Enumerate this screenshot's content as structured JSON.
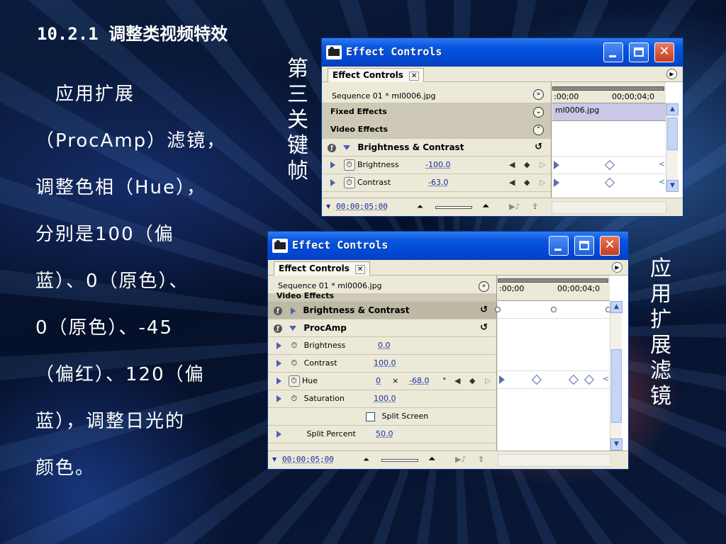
{
  "slide": {
    "title": "10.2.1 调整类视频特效",
    "body_lines": [
      "　应用扩展",
      "（ProcAmp）滤镜，",
      "调整色相（Hue），",
      "分别是100（偏",
      "蓝）、0（原色）、",
      "0（原色）、-45",
      "（偏红）、120（偏",
      "蓝），调整日光的",
      "颜色。"
    ],
    "label_keyframes": [
      "第",
      "三",
      "关",
      "键",
      "帧"
    ],
    "label_procamp": [
      "应",
      "用",
      "扩",
      "展",
      "滤",
      "镜"
    ]
  },
  "window1": {
    "title": "Effect Controls",
    "tab": "Effect Controls",
    "sequence": "Sequence 01 * ml0006.jpg",
    "ruler_start": ":00;00",
    "ruler_end": "00;00;04;0",
    "clip_name": "ml0006.jpg",
    "fixed_effects": "Fixed Effects",
    "video_effects": "Video Effects",
    "effect_group": "Brightness & Contrast",
    "params": [
      {
        "name": "Brightness",
        "value": "-100.0"
      },
      {
        "name": "Contrast",
        "value": "-63.0"
      }
    ],
    "timecode": "00;00;05;00"
  },
  "window2": {
    "title": "Effect Controls",
    "tab": "Effect Controls",
    "sequence": "Sequence 01 * ml0006.jpg",
    "ruler_start": ":00;00",
    "ruler_end": "00;00;04;0",
    "video_effects": "Video Effects",
    "effect_group_1": "Brightness & Contrast",
    "effect_group_2": "ProcAmp",
    "params": [
      {
        "name": "Brightness",
        "value": "0.0"
      },
      {
        "name": "Contrast",
        "value": "100.0"
      },
      {
        "name": "Hue",
        "value": "0",
        "value2": "-68.0",
        "sep": "×",
        "unit": "°"
      },
      {
        "name": "Saturation",
        "value": "100.0"
      }
    ],
    "split_screen": "Split Screen",
    "split_percent_label": "Split Percent",
    "split_percent_value": "50.0",
    "timecode": "00;00;05;00"
  },
  "colors": {
    "titlebar_blue": "#0049d6",
    "close_red": "#c63c1f",
    "value_blue": "#1a2fa0",
    "panel_beige": "#ece9d8"
  }
}
